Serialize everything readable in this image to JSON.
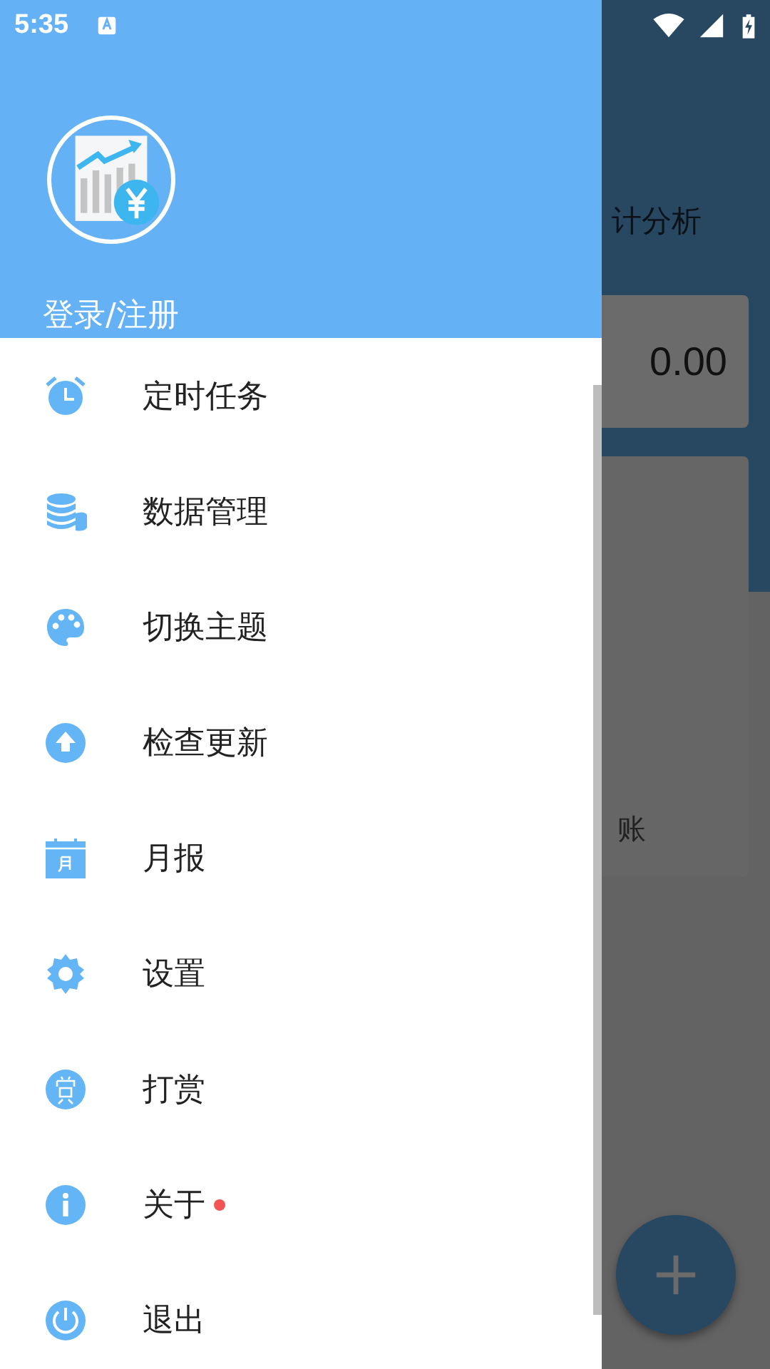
{
  "status_bar": {
    "time": "5:35"
  },
  "background_app": {
    "tab_label": "计分析",
    "card_amount": "0.00",
    "card_label": "账"
  },
  "drawer": {
    "header": {
      "login": "登录/注册"
    },
    "items": [
      {
        "label": "定时任务",
        "dot": false
      },
      {
        "label": "数据管理",
        "dot": false
      },
      {
        "label": "切换主题",
        "dot": false
      },
      {
        "label": "检查更新",
        "dot": false
      },
      {
        "label": "月报",
        "dot": false
      },
      {
        "label": "设置",
        "dot": false
      },
      {
        "label": "打赏",
        "dot": false
      },
      {
        "label": "关于",
        "dot": true
      },
      {
        "label": "退出",
        "dot": false
      }
    ]
  }
}
